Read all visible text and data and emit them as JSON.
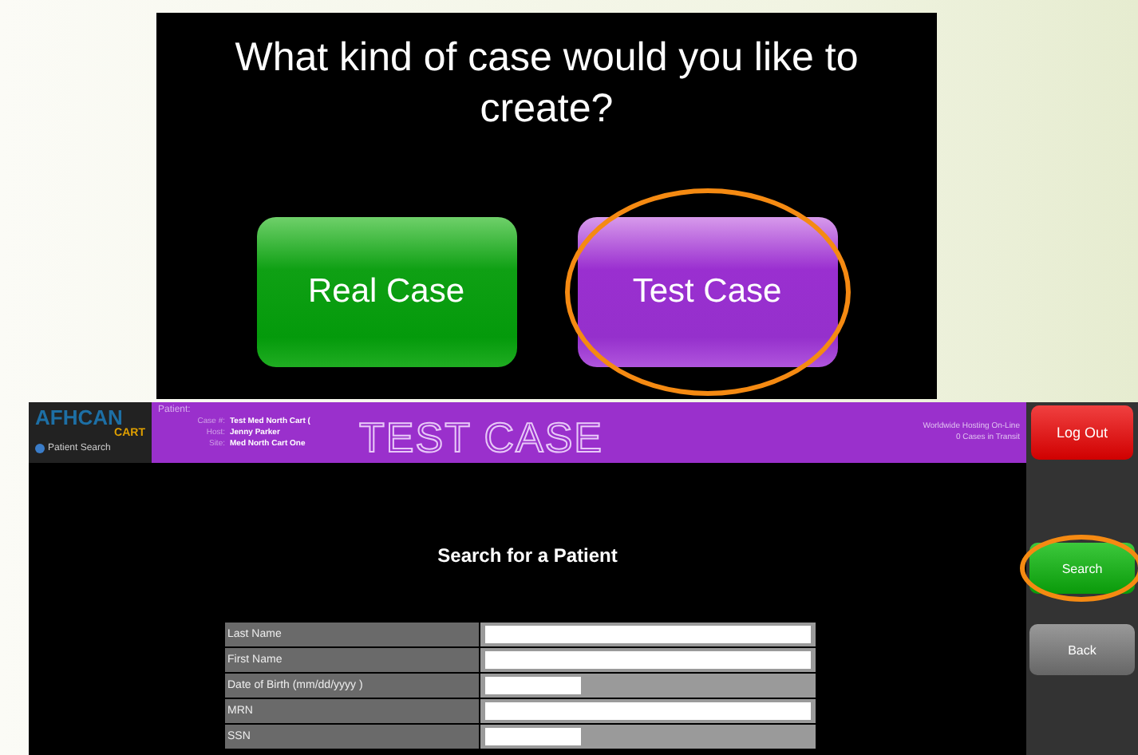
{
  "case_dialog": {
    "question": "What kind of case would you like to create?",
    "buttons": [
      {
        "label": "Real Case",
        "kind": "real",
        "circled": false
      },
      {
        "label": "Test Case",
        "kind": "test",
        "circled": true
      }
    ]
  },
  "app": {
    "logo": {
      "name": "AFHCAN",
      "sub": "CART"
    },
    "nav_link": "Patient Search",
    "header": {
      "patient_label": "Patient:",
      "details": [
        {
          "label": "Case #:",
          "value": "Test Med North Cart ("
        },
        {
          "label": "Host:",
          "value": "Jenny Parker"
        },
        {
          "label": "Site:",
          "value": "Med North Cart One"
        }
      ],
      "banner": "TEST CASE",
      "status_lines": [
        "Worldwide Hosting On-Line",
        "0 Cases in Transit"
      ]
    },
    "logout": "Log Out",
    "title": "Search for a Patient",
    "fields": [
      {
        "label": "Last Name",
        "kind": "full"
      },
      {
        "label": "First Name",
        "kind": "full"
      },
      {
        "label": "Date of Birth (mm/dd/yyyy )",
        "kind": "short"
      },
      {
        "label": "MRN",
        "kind": "full"
      },
      {
        "label": "SSN",
        "kind": "short"
      }
    ],
    "side_buttons": [
      {
        "label": "Search",
        "kind": "search",
        "circled": true
      },
      {
        "label": "Back",
        "kind": "back",
        "circled": false
      }
    ]
  }
}
